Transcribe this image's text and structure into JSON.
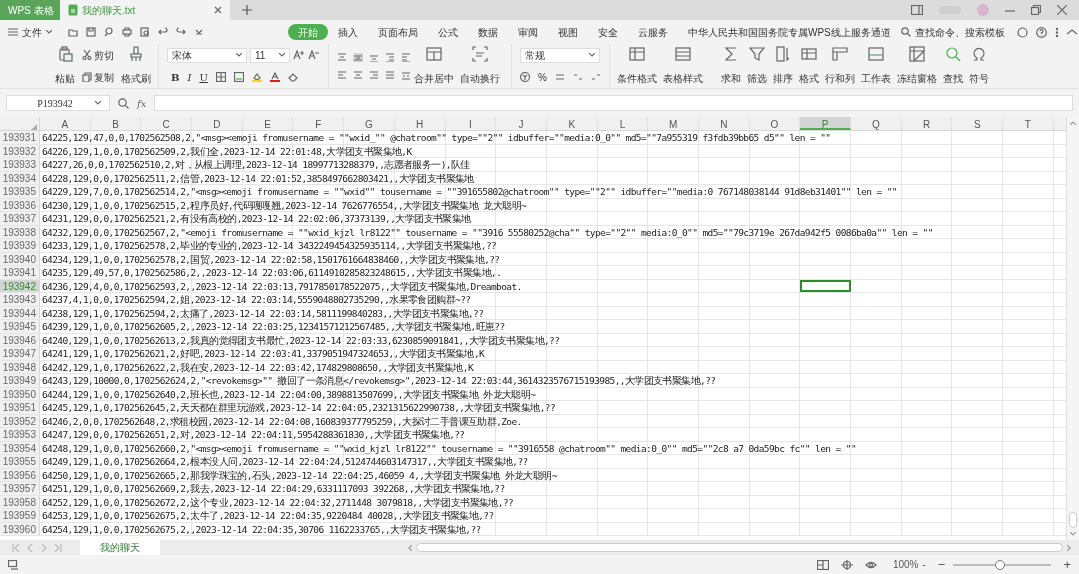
{
  "title_tabs": [
    {
      "label": "WPS 表格",
      "kind": "app"
    },
    {
      "label": "我的聊天.txt",
      "kind": "doc"
    }
  ],
  "menu": {
    "file": "文件",
    "tabs": [
      {
        "label": "开始",
        "selected": true
      },
      {
        "label": "插入",
        "selected": false
      },
      {
        "label": "页面布局",
        "selected": false
      },
      {
        "label": "公式",
        "selected": false
      },
      {
        "label": "数据",
        "selected": false
      },
      {
        "label": "审阅",
        "selected": false
      },
      {
        "label": "视图",
        "selected": false
      },
      {
        "label": "安全",
        "selected": false
      },
      {
        "label": "云服务",
        "selected": false
      },
      {
        "label": "中华人民共和国国务院专属WPS线上服务通道",
        "selected": false
      }
    ],
    "search": "查找命令、搜索模板"
  },
  "ribbon": {
    "paste": "粘贴",
    "cut": "剪切",
    "copy": "复制",
    "format_painter": "格式刷",
    "font": "宋体",
    "font_size": "11",
    "format_buttons": [
      "B",
      "I",
      "U"
    ],
    "merge": "合并居中",
    "wrap": "自动换行",
    "number_format": "常规",
    "percent": "%",
    "tools": [
      "条件格式",
      "表格样式",
      "求和",
      "筛选",
      "排序",
      "格式",
      "行和列",
      "工作表",
      "冻结窗格",
      "查找",
      "符号"
    ]
  },
  "formula_bar": {
    "name_box": "P193942",
    "function_label": "fx"
  },
  "columns": [
    {
      "label": "A",
      "selected": false
    },
    {
      "label": "B",
      "selected": false
    },
    {
      "label": "C",
      "selected": false
    },
    {
      "label": "D",
      "selected": false
    },
    {
      "label": "E",
      "selected": false
    },
    {
      "label": "F",
      "selected": false
    },
    {
      "label": "G",
      "selected": false
    },
    {
      "label": "H",
      "selected": false
    },
    {
      "label": "I",
      "selected": false
    },
    {
      "label": "J",
      "selected": false
    },
    {
      "label": "K",
      "selected": false
    },
    {
      "label": "L",
      "selected": false
    },
    {
      "label": "M",
      "selected": false
    },
    {
      "label": "N",
      "selected": false
    },
    {
      "label": "O",
      "selected": false
    },
    {
      "label": "P",
      "selected": true
    },
    {
      "label": "Q",
      "selected": false
    },
    {
      "label": "R",
      "selected": false
    },
    {
      "label": "S",
      "selected": false
    },
    {
      "label": "T",
      "selected": false
    }
  ],
  "rows": [
    {
      "number": "193931",
      "text": "64225,129,47,0,0,1702562508,2,\"<msg><emoji fromusername = \"\"wxid_\"\" @chatroom\"\" type=\"\"2\"\" idbuffer=\"\"media:0_0\"\" md5=\"\"7a955319 f3fdb39bb65 d5\"\" len = \"\"",
      "selected": false
    },
    {
      "number": "193932",
      "text": "64226,129,1,0,0,1702562509,2,我们全,2023-12-14 22:01:48,大学团支书聚集地,K",
      "selected": false
    },
    {
      "number": "193933",
      "text": "64227,26,0,0,1702562510,2,对，从根上调理,2023-12-14 18997713288379,,志愿者服务一),队佳",
      "selected": false
    },
    {
      "number": "193934",
      "text": "64228,129,0,0,1702562511,2,信管,2023-12-14 22:01:52,3858497662803421,,大学团支书聚集地",
      "selected": false
    },
    {
      "number": "193935",
      "text": "64229,129,7,0,0,1702562514,2,\"<msg><emoji fromusername = \"\"wxid\"\" tousername = \"\"391655802@chatroom\"\" type=\"\"2\"\" idbuffer=\"\"media:0 767148038144 91d8eb31401\"\" len = \"\"",
      "selected": false
    },
    {
      "number": "193936",
      "text": "64230,129,1,0,0,1702562515,2,程序员好,代码嘎嘎翘,2023-12-14 7626776554,,大学团支书聚集地 龙大聪明~",
      "selected": false
    },
    {
      "number": "193937",
      "text": "64231,129,0,0,1702562521,2,有没有高校的,2023-12-14 22:02:06,37373139,,大学团支书聚集地",
      "selected": false
    },
    {
      "number": "193938",
      "text": "64232,129,0,0,1702562567,2,\"<emoji fromusername = \"\"wxid_kjzl lr8122\"\" tousername = \"\"3916 55580252@cha\"\" type=\"\"2\"\" media:0_0\"\" md5=\"\"79c3719e 267da942f5 0086ba0a\"\" len = \"\"",
      "selected": false
    },
    {
      "number": "193939",
      "text": "64233,129,1,0,1702562578,2,毕业的专业的,2023-12-14 3432249454325935114,,大学团支书聚集地,??",
      "selected": false
    },
    {
      "number": "193940",
      "text": "64234,129,1,0,0,1702562578,2,国贸,2023-12-14 22:02:58,1501761664838460,,大学团支书聚集地,??",
      "selected": false
    },
    {
      "number": "193941",
      "text": "64235,129,49,57,0,1702562586,2,,2023-12-14 22:03:06,6114910285823248615,,大学团支书聚集地,.",
      "selected": false
    },
    {
      "number": "193942",
      "text": "64236,129,4,0,0,1702562593,2,,2023-12-14 22:03:13,7917850178522075,,大学团支书聚集地,Dreamboat.",
      "selected": true
    },
    {
      "number": "193943",
      "text": "64237,4,1,0,0,1702562594,2,姐,2023-12-14 22:03:14,5559048802735290,,水果零食团购群~??",
      "selected": false
    },
    {
      "number": "193944",
      "text": "64238,129,1,0,1702562594,2,太痛了,2023-12-14 22:03:14,5811199840283,,大学团支书聚集地,??",
      "selected": false
    },
    {
      "number": "193945",
      "text": "64239,129,1,0,0,1702562605,2,,2023-12-14 22:03:25,12341571212567485,,大学团支书聚集地,旺崽??",
      "selected": false
    },
    {
      "number": "193946",
      "text": "64240,129,1,0,0,1702562613,2,我真的觉得团支书最忙,2023-12-14 22:03:33,6230859091841,,大学团支书聚集地,??",
      "selected": false
    },
    {
      "number": "193947",
      "text": "64241,129,1,0,1702562621,2,好吧,2023-12-14 22:03:41,3379051947324653,,大学团支书聚集地,K",
      "selected": false
    },
    {
      "number": "193948",
      "text": "64242,129,1,0,1702562622,2,我在安,2023-12-14 22:03:42,174829808650,,大学团支书聚集地,K",
      "selected": false
    },
    {
      "number": "193949",
      "text": "64243,129,10000,0,1702562624,2,\"<revokemsg>\"\" 撤回了一条消息</revokemsg>\",2023-12-14 22:03:44,3614323576715193985,,大学团支书聚集地,??",
      "selected": false
    },
    {
      "number": "193950",
      "text": "64244,129,1,0,0,1702562640,2,班长也,2023-12-14 22:04:00,3898813507699,,大学团支书聚集地 外龙大聪明~",
      "selected": false
    },
    {
      "number": "193951",
      "text": "64245,129,1,0,1702562645,2,天天都在群里玩游戏,2023-12-14 22:04:05,2321315622990738,,大学团支书聚集地,??",
      "selected": false
    },
    {
      "number": "193952",
      "text": "64246,2,0,0,1702562648,2,求租校园,2023-12-14 22:04:08,160839377795259,,大探讨二手普课互助群,Zoe.",
      "selected": false
    },
    {
      "number": "193953",
      "text": "64247,129,0,0,1702562651,2,对,2023-12-14 22:04:11,5954288361830,,大学团支书聚集地,??",
      "selected": false
    },
    {
      "number": "193954",
      "text": "64248,129,1,0,0,1702562660,2,\"<msg><emoji fromusername = \"\"wxid_kjzl lr8122\"\" tousername = \"\"3916558 @chatroom\"\" media:0_0\"\" md5=\"\"2c8 a7 0da59bc fc\"\" len = \"\"",
      "selected": false
    },
    {
      "number": "193955",
      "text": "64249,129,1,0,0,1702562664,2,根本没人问,2023-12-14 22:04:24,5124744603147317,,大学团支书聚集地,??",
      "selected": false
    },
    {
      "number": "193956",
      "text": "64250,129,1,0,0,1702562665,2,那我学珠宝的,石头,2023-12-14 22:04:25,46059 4,,大学团支书聚集地 外龙大聪明~",
      "selected": false
    },
    {
      "number": "193957",
      "text": "64251,129,1,0,0,1702562669,2,我去,2023-12-14 22:04:29,6331117093 392268,,大学团支书聚集地,??",
      "selected": false
    },
    {
      "number": "193958",
      "text": "64252,129,1,0,0,1702562672,2,这个专业,2023-12-14 22:04:32,2711448 3079818,,大学团支书聚集地,??",
      "selected": false
    },
    {
      "number": "193959",
      "text": "64253,129,1,0,0,1702562675,2,太牛了,2023-12-14 22:04:35,9220484 40028,,大学团支书聚集地,??",
      "selected": false
    },
    {
      "number": "193960",
      "text": "64254,129,1,0,0,1702562675,2,,2023-12-14 22:04:35,30706 1162233765,,大学团支书聚集地,??",
      "selected": false
    }
  ],
  "sheet_tabs": [
    {
      "label": "我的聊天",
      "selected": true
    }
  ],
  "status_bar": {
    "zoom": "100%",
    "zoom_minus": "-",
    "zoom_out": "−",
    "zoom_in": "+",
    "zoom_level": {
      "level": 0.48
    }
  }
}
